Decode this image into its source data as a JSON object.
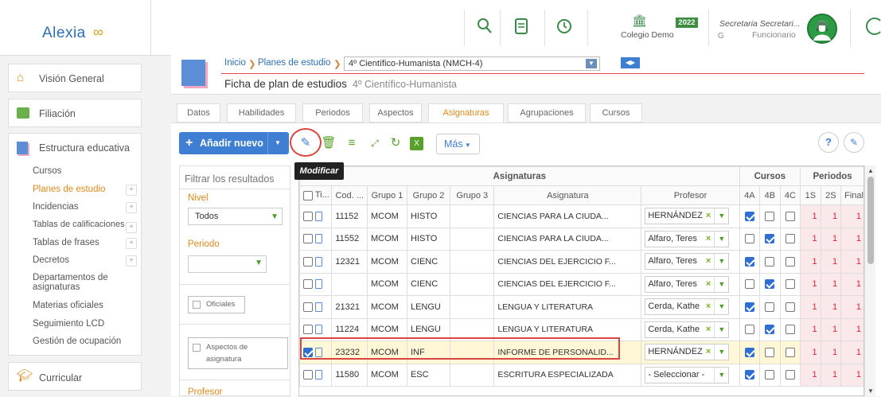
{
  "app": {
    "logo": "Alexia",
    "logo_mark": "∞"
  },
  "topbar": {
    "school_name": "Colegio Demo",
    "year_badge": "2022",
    "user_title": "Secretaria Secretari...",
    "user_role": "Funcionario",
    "user_prefix": "G"
  },
  "sidebar": {
    "vision": "Visión General",
    "filiacion": "Filiación",
    "estructura": "Estructura educativa",
    "curricular": "Curricular",
    "sub_items": [
      "Cursos",
      "Planes de estudio",
      "Incidencias",
      "Tablas de calificaciones",
      "Tablas de frases",
      "Decretos",
      "Departamentos de asignaturas",
      "Materias oficiales",
      "Seguimiento LCD",
      "Gestión de ocupación"
    ]
  },
  "header": {
    "crumb_home": "Inicio",
    "crumb_plans": "Planes de estudio",
    "crumb_select": "4º Científico-Humanista (NMCH-4)",
    "title": "Ficha de plan de estudios",
    "subtitle": "4º Científico-Humanista"
  },
  "tabs": [
    "Datos",
    "Habilidades",
    "Periodos",
    "Aspectos",
    "Asignaturas",
    "Agrupaciones",
    "Cursos"
  ],
  "toolbar": {
    "add_label": "Añadir nuevo",
    "more_label": "Más",
    "tooltip": "Modificar"
  },
  "filter": {
    "placeholder": "Filtrar los resultados",
    "nivel_label": "Nivel",
    "nivel_value": "Todos",
    "periodo_label": "Periodo",
    "oficiales_label": "Oficiales",
    "aspectos_label": "Aspectos de asignatura",
    "profesor_label": "Profesor"
  },
  "grid": {
    "group_asignaturas": "Asignaturas",
    "group_cursos": "Cursos",
    "group_periodos": "Periodos",
    "columns": [
      "Ti...",
      "Cod. ...",
      "Grupo 1",
      "Grupo 2",
      "Grupo 3",
      "Asignatura",
      "Profesor",
      "4A",
      "4B",
      "4C",
      "1S",
      "2S",
      "Final"
    ],
    "rows": [
      {
        "cod": "11152",
        "g1": "MCOM",
        "g2": "HISTO",
        "asig": "CIENCIAS PARA LA CIUDA...",
        "prof": "HERNÁNDEZ",
        "c4a": true,
        "c4b": false,
        "c4c": false,
        "p1": "1",
        "p2": "1",
        "pf": "1",
        "sel": false
      },
      {
        "cod": "11552",
        "g1": "MCOM",
        "g2": "HISTO",
        "asig": "CIENCIAS PARA LA CIUDA...",
        "prof": "Alfaro, Teres",
        "c4a": false,
        "c4b": true,
        "c4c": false,
        "p1": "1",
        "p2": "1",
        "pf": "1",
        "sel": false
      },
      {
        "cod": "12321",
        "g1": "MCOM",
        "g2": "CIENC",
        "asig": "CIENCIAS DEL EJERCICIO F...",
        "prof": "Alfaro, Teres",
        "c4a": true,
        "c4b": false,
        "c4c": false,
        "p1": "1",
        "p2": "1",
        "pf": "1",
        "sel": false
      },
      {
        "cod": "",
        "g1": "MCOM",
        "g2": "CIENC",
        "asig": "CIENCIAS DEL EJERCICIO F...",
        "prof": "Alfaro, Teres",
        "c4a": false,
        "c4b": true,
        "c4c": false,
        "p1": "1",
        "p2": "1",
        "pf": "1",
        "sel": false
      },
      {
        "cod": "21321",
        "g1": "MCOM",
        "g2": "LENGU",
        "asig": "LENGUA Y LITERATURA",
        "prof": "Cerda, Kathe",
        "c4a": true,
        "c4b": false,
        "c4c": false,
        "p1": "1",
        "p2": "1",
        "pf": "1",
        "sel": false
      },
      {
        "cod": "11224",
        "g1": "MCOM",
        "g2": "LENGU",
        "asig": "LENGUA Y LITERATURA",
        "prof": "Cerda, Kathe",
        "c4a": false,
        "c4b": true,
        "c4c": false,
        "p1": "1",
        "p2": "1",
        "pf": "1",
        "sel": false
      },
      {
        "cod": "23232",
        "g1": "MCOM",
        "g2": "INF",
        "asig": "INFORME DE PERSONALID...",
        "prof": "HERNÁNDEZ",
        "c4a": true,
        "c4b": false,
        "c4c": false,
        "p1": "1",
        "p2": "1",
        "pf": "1",
        "sel": true
      },
      {
        "cod": "11580",
        "g1": "MCOM",
        "g2": "ESC",
        "asig": "ESCRITURA ESPECIALIZADA",
        "prof": "- Seleccionar -",
        "c4a": true,
        "c4b": false,
        "c4c": false,
        "p1": "1",
        "p2": "1",
        "pf": "1",
        "sel": false
      }
    ]
  },
  "colors": {
    "accent": "#3f7fd3",
    "highlight": "#d9463f",
    "green": "#3a8a4a"
  }
}
